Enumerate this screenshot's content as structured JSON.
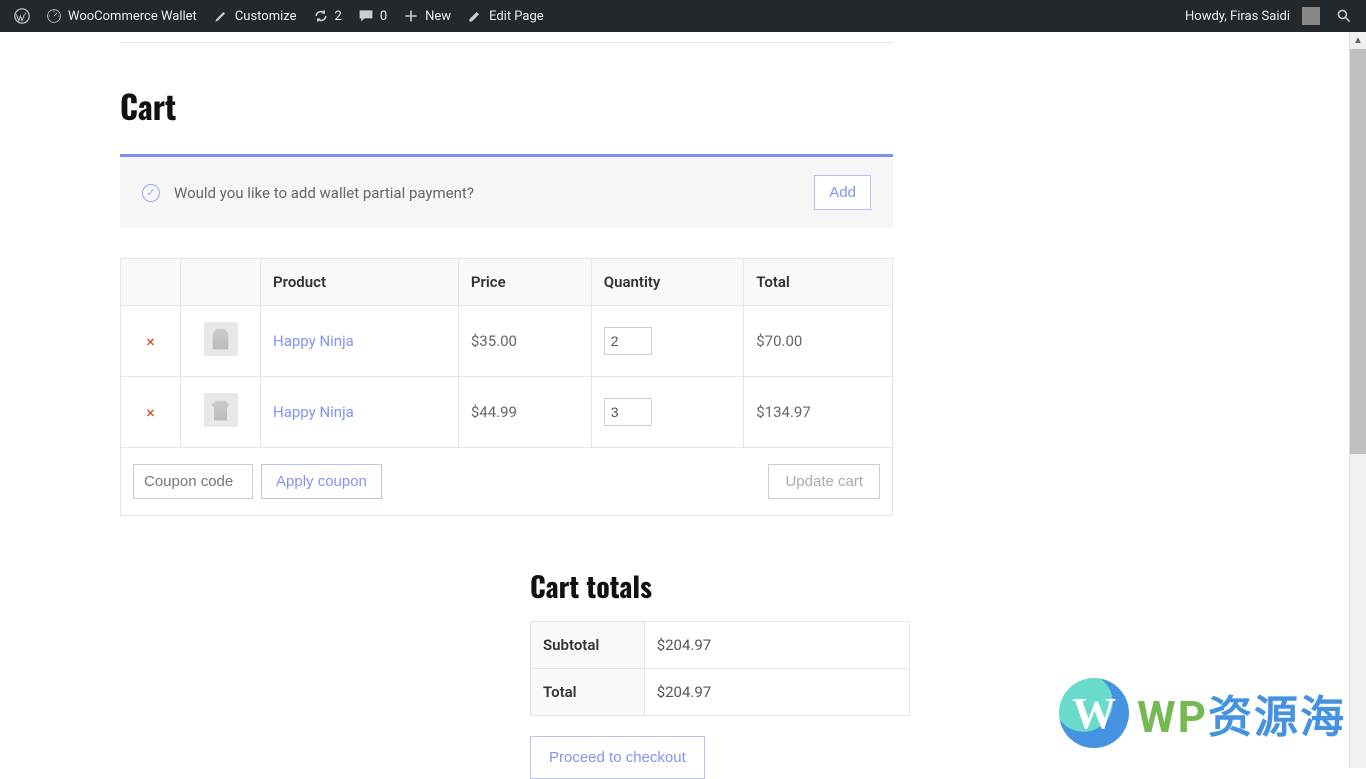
{
  "admin_bar": {
    "site_name": "WooCommerce Wallet",
    "customize": "Customize",
    "updates_count": "2",
    "comments_count": "0",
    "new_label": "New",
    "edit_page": "Edit Page",
    "howdy": "Howdy, Firas Saidi"
  },
  "page": {
    "title": "Cart"
  },
  "wallet_notice": {
    "message": "Would you like to add wallet partial payment?",
    "add_label": "Add"
  },
  "cart_table": {
    "headers": {
      "product": "Product",
      "price": "Price",
      "quantity": "Quantity",
      "total": "Total"
    },
    "rows": [
      {
        "name": "Happy Ninja",
        "price": "$35.00",
        "qty": "2",
        "total": "$70.00",
        "thumb": "hoodie"
      },
      {
        "name": "Happy Ninja",
        "price": "$44.99",
        "qty": "3",
        "total": "$134.97",
        "thumb": "tshirt"
      }
    ],
    "coupon_placeholder": "Coupon code",
    "apply_coupon": "Apply coupon",
    "update_cart": "Update cart"
  },
  "cart_totals": {
    "title": "Cart totals",
    "subtotal_label": "Subtotal",
    "subtotal_value": "$204.97",
    "total_label": "Total",
    "total_value": "$204.97",
    "checkout": "Proceed to checkout"
  },
  "watermark": {
    "text_cn": "资源海",
    "text_wp": "WP"
  }
}
